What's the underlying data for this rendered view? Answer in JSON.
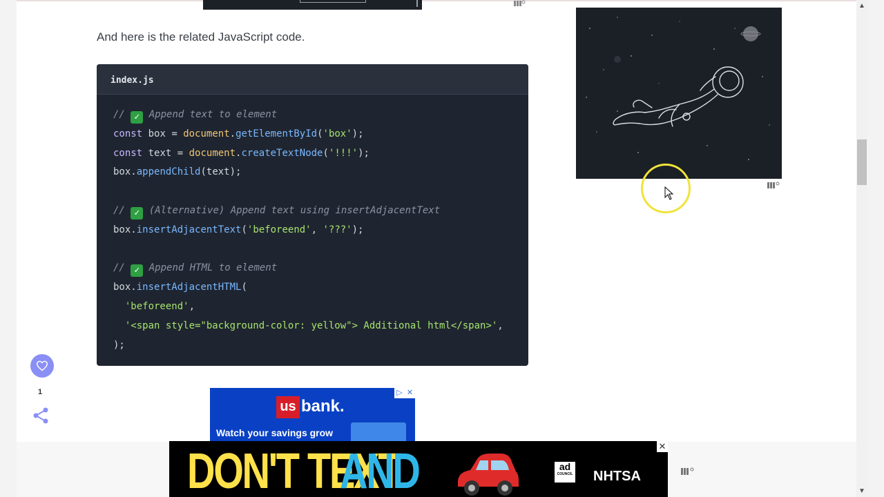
{
  "intro_text": "And here is the related JavaScript code.",
  "code": {
    "filename": "index.js",
    "comments": {
      "c1": "// ✅ Append text to element",
      "c2": "// ✅ (Alternative) Append text using insertAdjacentText",
      "c3": "// ✅ Append HTML to element"
    },
    "tokens": {
      "const": "const",
      "box": "box",
      "text": "text",
      "document": "document",
      "getElementById": "getElementById",
      "createTextNode": "createTextNode",
      "appendChild": "appendChild",
      "insertAdjacentText": "insertAdjacentText",
      "insertAdjacentHTML": "insertAdjacentHTML",
      "str_box": "'box'",
      "str_bang": "'!!!'",
      "str_beforeend": "'beforeend'",
      "str_qqq": "'???'",
      "str_html": "'<span style=\"background-color: yellow\"> Additional html</span>'"
    }
  },
  "sidebar_actions": {
    "like_count": "1"
  },
  "bank_ad": {
    "logo_us": "us",
    "logo_bank": "bank.",
    "tagline": "Watch your savings grow",
    "ad_choice": "▷",
    "close": "✕"
  },
  "bottom_banner": {
    "text_yellow": "DON'T TEXT",
    "text_blue": "AND",
    "ad_council_line1": "ad",
    "ad_council_line2": "COUNCIL",
    "nhtsa": "NHTSA",
    "close": "✕"
  },
  "icons": {
    "like": "heart-icon",
    "share": "share-icon",
    "cursor": "mouse-pointer-icon",
    "ezoic": "ezoic-icon"
  },
  "colors": {
    "code_bg": "#1f2530",
    "accent_purple": "#8a8ff5",
    "cursor_highlight": "#f0e33a",
    "bank_blue": "#0a41c4",
    "bank_red": "#d71e28"
  }
}
